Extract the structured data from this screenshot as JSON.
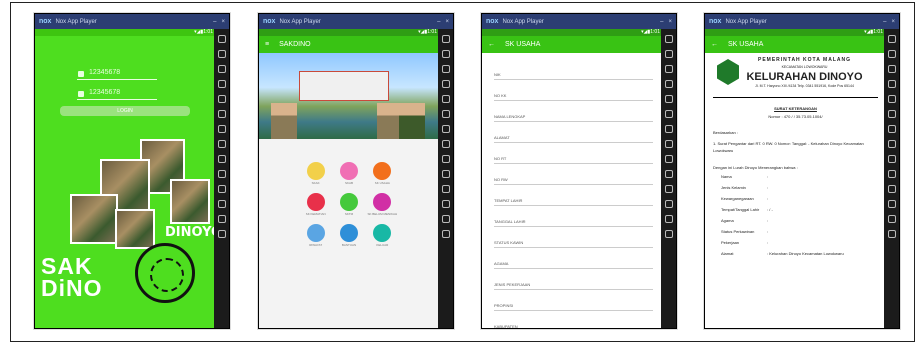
{
  "window": {
    "app_title": "Nox App Player",
    "controls": [
      "▾",
      "⚙",
      "⚙",
      "–",
      "□",
      "×"
    ],
    "status": "▾◢▮1:01"
  },
  "screen1": {
    "username": "12345678",
    "password": "12345678",
    "login_label": "LOGIN",
    "brand_line1": "SAK",
    "brand_line2": "DiNO",
    "dinoyo": "DINOYO"
  },
  "screen2": {
    "title": "SAKDINO",
    "menu": [
      {
        "label": "SKAK",
        "color": "#f2d04a"
      },
      {
        "label": "SKAB",
        "color": "#f06fb4"
      },
      {
        "label": "SK USAHA",
        "color": "#f26f1c"
      },
      {
        "label": "SK KEMATIAN",
        "color": "#e8304a"
      },
      {
        "label": "SKTM",
        "color": "#45c93c"
      },
      {
        "label": "SK BELUM MENIKAH",
        "color": "#d12fa5"
      },
      {
        "label": "RIWAYAT",
        "color": "#5aa5e3"
      },
      {
        "label": "BANTUAN",
        "color": "#2e8fd8"
      },
      {
        "label": "KELUAR",
        "color": "#18b8a5"
      }
    ]
  },
  "screen3": {
    "title": "SK USAHA",
    "fields": [
      "NIK",
      "NO KK",
      "NAMA LENGKAP",
      "ALAMAT",
      "NO RT",
      "NO RW",
      "TEMPAT LAHIR",
      "TANGGAL LAHIR",
      "STATUS KAWIN",
      "AGAMA",
      "JENIS PEKERJAAN",
      "PROPINSI",
      "KABUPATEN",
      "KECAMATAN"
    ]
  },
  "screen4": {
    "title": "SK USAHA",
    "gov": "PEMERINTAH KOTA MALANG",
    "kecamatan": "KECAMATAN LOWOKWARU",
    "kelurahan": "KELURAHAN DINOYO",
    "address": "Jl. M.T. Haryono XIII /4134 Telp. 0341 551916, Kode Pos 65144",
    "subject": "SURAT KETERANGAN",
    "nomor": "Nomor : 470 / / 35.73.05.1004/",
    "para1": "Berdasarkan :",
    "para2": "1. Surat Pengantar dari RT. 0 RW. 0 Nomor: Tanggal: - Kelurahan Dinoyo Kecamatan Lowokwaru",
    "para3": "Dengan ini Lurah Dinoyo Menerangkan bahwa :",
    "rows": [
      {
        "k": "Nama",
        "v": ":"
      },
      {
        "k": "Jenis Kelamin",
        "v": ":"
      },
      {
        "k": "Kewarganegaraan",
        "v": ":"
      },
      {
        "k": "Tempat/Tanggal Lahir",
        "v": ":  / -"
      },
      {
        "k": "Agama",
        "v": ":"
      },
      {
        "k": "Status Perkawinan",
        "v": ":"
      },
      {
        "k": "Pekerjaan",
        "v": ":"
      },
      {
        "k": "Alamat",
        "v": ":  Kelurahan Dinoyo Kecamatan Lowokwaru"
      }
    ]
  }
}
